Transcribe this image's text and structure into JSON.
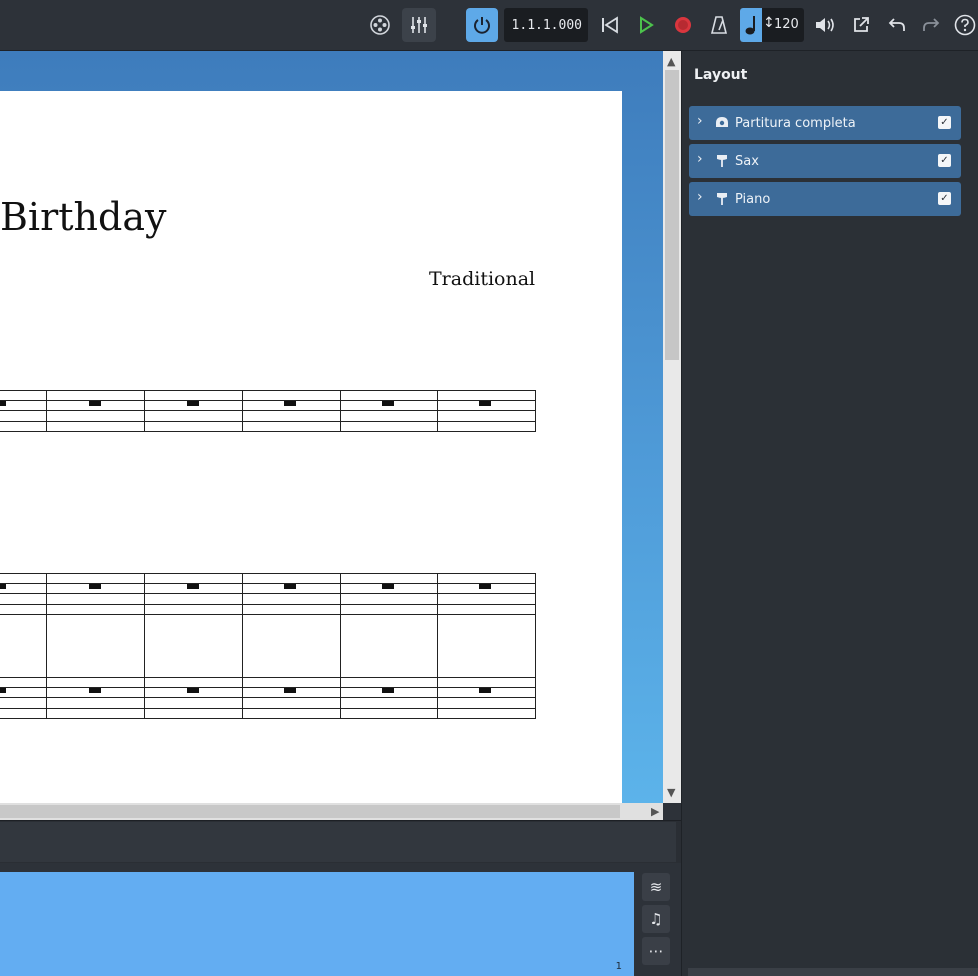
{
  "toolbar": {
    "position": "1.1.1.000",
    "tempo": "120"
  },
  "score": {
    "title": "Birthday",
    "composer": "Traditional"
  },
  "piano_roll": {
    "page_number": "1"
  },
  "layout_panel": {
    "title": "Layout",
    "items": [
      {
        "label": "Partitura completa",
        "checked": true,
        "icon": "full-score-icon"
      },
      {
        "label": "Sax",
        "checked": true,
        "icon": "instrument-icon"
      },
      {
        "label": "Piano",
        "checked": true,
        "icon": "instrument-icon"
      }
    ]
  },
  "colors": {
    "accent": "#5ea9e8",
    "play": "#4cc24c",
    "record": "#d9363e",
    "panel_row": "#3d6b99"
  }
}
